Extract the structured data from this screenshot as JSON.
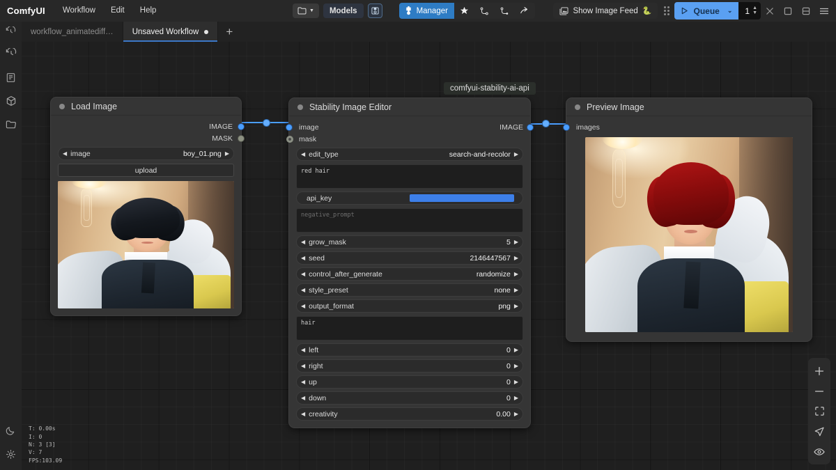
{
  "app": {
    "brand": "ComfyUI"
  },
  "menu": {
    "items": [
      "Workflow",
      "Edit",
      "Help"
    ]
  },
  "toolbar": {
    "folder_label": "",
    "models_label": "Models",
    "manager_label": "Manager",
    "show_image_feed_label": "Show Image Feed",
    "show_image_feed_emoji": "🐍",
    "queue_label": "Queue",
    "queue_count": "1",
    "icons": [
      "folder-icon",
      "chevron-down-icon",
      "save-icon",
      "manager-puzzle-icon",
      "star-icon",
      "node-map-icon",
      "node-map-alt-icon",
      "share-icon",
      "image-feed-icon",
      "drag-handle-icon",
      "play-icon",
      "close-icon",
      "maximize-icon",
      "panel-icon",
      "hamburger-icon"
    ]
  },
  "tabs": {
    "history_icon": "history-icon",
    "items": [
      {
        "label": "workflow_animatediff…",
        "active": false,
        "modified": false
      },
      {
        "label": "Unsaved Workflow",
        "active": true,
        "modified": true
      }
    ],
    "add_label": "+"
  },
  "sidebar": {
    "items": [
      {
        "name": "queue-history",
        "icon": "history-icon"
      },
      {
        "name": "node-library",
        "icon": "book-icon"
      },
      {
        "name": "model-library",
        "icon": "cube-icon"
      },
      {
        "name": "workflows-browser",
        "icon": "folder-icon"
      }
    ],
    "bottom": [
      {
        "name": "theme-toggle",
        "icon": "moon-icon"
      },
      {
        "name": "settings",
        "icon": "gear-icon"
      }
    ]
  },
  "canvas": {
    "group_label": "comfyui-stability-ai-api",
    "stats": [
      "T: 0.00s",
      "I: 0",
      "N: 3 [3]",
      "V: 7",
      "FPS:103.09"
    ]
  },
  "nodes": {
    "load_image": {
      "title": "Load Image",
      "outputs": [
        {
          "label": "IMAGE",
          "connected": true
        },
        {
          "label": "MASK",
          "connected": false
        }
      ],
      "widgets": [
        {
          "type": "combo",
          "name": "image",
          "value": "boy_01.png"
        },
        {
          "type": "button",
          "label": "upload"
        }
      ]
    },
    "stability": {
      "title": "Stability Image Editor",
      "inputs": [
        {
          "label": "image",
          "connected": true
        },
        {
          "label": "mask",
          "connected": false
        }
      ],
      "outputs": [
        {
          "label": "IMAGE",
          "connected": true
        }
      ],
      "widgets": [
        {
          "type": "combo",
          "name": "edit_type",
          "value": "search-and-recolor"
        },
        {
          "type": "textarea",
          "name": "prompt",
          "value": "red hair",
          "placeholder": ""
        },
        {
          "type": "text",
          "name": "api_key",
          "value": "",
          "selected": true
        },
        {
          "type": "textarea",
          "name": "negative_prompt",
          "value": "",
          "placeholder": "negative_prompt"
        },
        {
          "type": "number",
          "name": "grow_mask",
          "value": "5"
        },
        {
          "type": "number",
          "name": "seed",
          "value": "2146447567"
        },
        {
          "type": "combo",
          "name": "control_after_generate",
          "value": "randomize"
        },
        {
          "type": "combo",
          "name": "style_preset",
          "value": "none"
        },
        {
          "type": "combo",
          "name": "output_format",
          "value": "png"
        },
        {
          "type": "textarea",
          "name": "search_prompt",
          "value": "hair",
          "placeholder": ""
        },
        {
          "type": "number",
          "name": "left",
          "value": "0"
        },
        {
          "type": "number",
          "name": "right",
          "value": "0"
        },
        {
          "type": "number",
          "name": "up",
          "value": "0"
        },
        {
          "type": "number",
          "name": "down",
          "value": "0"
        },
        {
          "type": "number",
          "name": "creativity",
          "value": "0.00"
        }
      ]
    },
    "preview_image": {
      "title": "Preview Image",
      "inputs": [
        {
          "label": "images",
          "connected": true
        }
      ]
    }
  },
  "right_controls": {
    "items": [
      {
        "name": "zoom-in",
        "icon": "plus-icon"
      },
      {
        "name": "zoom-out",
        "icon": "minus-icon"
      },
      {
        "name": "fit-view",
        "icon": "fit-frame-icon"
      },
      {
        "name": "select-mode",
        "icon": "cursor-arrow-icon"
      },
      {
        "name": "toggle-visibility",
        "icon": "eye-icon"
      }
    ]
  },
  "colors": {
    "accent_blue": "#4a9eff",
    "queue_blue": "#5aa0f2",
    "manager_blue": "#2e7cc4",
    "canvas_bg": "#1f1f1f",
    "node_bg": "#353535"
  }
}
